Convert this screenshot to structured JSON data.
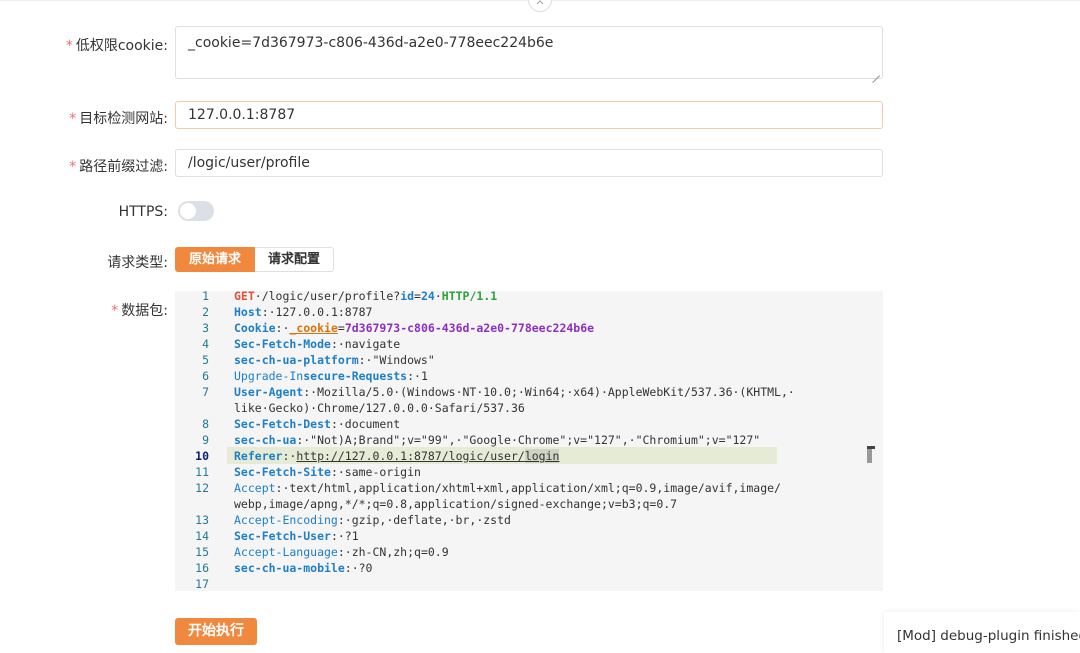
{
  "collapse_icon": "chevron-up-icon",
  "form": {
    "cookie": {
      "label": "低权限cookie",
      "required": "*",
      "colon": ":",
      "value": "_cookie=7d367973-c806-436d-a2e0-778eec224b6e"
    },
    "target": {
      "label": "目标检测网站",
      "required": "*",
      "colon": ":",
      "value": "127.0.0.1:8787"
    },
    "prefix": {
      "label": "路径前缀过滤",
      "required": "*",
      "colon": ":",
      "value": "/logic/user/profile"
    },
    "https": {
      "label": "HTTPS",
      "colon": ":",
      "enabled": false
    },
    "request_type": {
      "label": "请求类型",
      "colon": ":",
      "options": [
        "原始请求",
        "请求配置"
      ],
      "selected": "原始请求"
    },
    "packet": {
      "label": "数据包",
      "required": "*",
      "colon": ":"
    }
  },
  "editor": {
    "current_line": 10,
    "lines": [
      {
        "n": "1",
        "parts": [
          [
            "meth",
            "GET"
          ],
          [
            "",
            "·/logic/user/profile?"
          ],
          [
            "kb",
            "id"
          ],
          [
            "",
            "="
          ],
          [
            "kb",
            "24"
          ],
          [
            "",
            "·"
          ],
          [
            "proto",
            "HTTP/1.1"
          ]
        ]
      },
      {
        "n": "2",
        "parts": [
          [
            "kb",
            "Host"
          ],
          [
            "",
            ":·127.0.0.1:8787"
          ]
        ]
      },
      {
        "n": "3",
        "parts": [
          [
            "kb",
            "Cookie"
          ],
          [
            "",
            ":·"
          ],
          [
            "orange ul",
            "_cookie"
          ],
          [
            "",
            "="
          ],
          [
            "purple",
            "7d367973-c806-436d-a2e0-778eec224b6e"
          ]
        ]
      },
      {
        "n": "4",
        "parts": [
          [
            "kb",
            "Sec-Fetch-Mode"
          ],
          [
            "",
            ":·navigate"
          ]
        ]
      },
      {
        "n": "5",
        "parts": [
          [
            "kb",
            "sec-ch-ua-platform"
          ],
          [
            "",
            ":·\"Windows\""
          ]
        ]
      },
      {
        "n": "6",
        "parts": [
          [
            "k",
            "Upgrade-In"
          ],
          [
            "kb",
            "secure-Requests"
          ],
          [
            "",
            ":·1"
          ]
        ]
      },
      {
        "n": "7",
        "parts": [
          [
            "kb",
            "User-Agent"
          ],
          [
            "",
            ":·Mozilla/5.0·(Windows·NT·10.0;·Win64;·x64)·AppleWebKit/537.36·(KHTML,·"
          ]
        ]
      },
      {
        "n": "",
        "parts": [
          [
            "",
            "like·Gecko)·Chrome/127.0.0.0·Safari/537.36"
          ]
        ]
      },
      {
        "n": "8",
        "parts": [
          [
            "kb",
            "Sec-Fetch-Dest"
          ],
          [
            "",
            ":·document"
          ]
        ]
      },
      {
        "n": "9",
        "parts": [
          [
            "kb",
            "sec-ch-ua"
          ],
          [
            "",
            ":·\"Not)A;Brand\";v=\"99\",·\"Google·Chrome\";v=\"127\",·\"Chromium\";v=\"127\""
          ]
        ]
      },
      {
        "n": "10",
        "parts": [
          [
            "kb",
            "Referer"
          ],
          [
            "",
            ":·"
          ],
          [
            "ul",
            "http://127.0.0.1:8787/logic/user/"
          ],
          [
            "ul selword",
            "login"
          ]
        ]
      },
      {
        "n": "11",
        "parts": [
          [
            "kb",
            "Sec-Fetch-Site"
          ],
          [
            "",
            ":·same-origin"
          ]
        ]
      },
      {
        "n": "12",
        "parts": [
          [
            "k",
            "Accept"
          ],
          [
            "",
            ":·text/html,application/xhtml+xml,application/xml;q=0.9,image/avif,image/"
          ]
        ]
      },
      {
        "n": "",
        "parts": [
          [
            "",
            "webp,image/apng,*/*;q=0.8,application/signed-exchange;v=b3;q=0.7"
          ]
        ]
      },
      {
        "n": "13",
        "parts": [
          [
            "k",
            "Accept-Encoding"
          ],
          [
            "",
            ":·gzip,·deflate,·br,·zstd"
          ]
        ]
      },
      {
        "n": "14",
        "parts": [
          [
            "kb",
            "Sec-Fetch-User"
          ],
          [
            "",
            ":·?1"
          ]
        ]
      },
      {
        "n": "15",
        "parts": [
          [
            "k",
            "Accept-Language"
          ],
          [
            "",
            ":·zh-CN,zh;q=0.9"
          ]
        ]
      },
      {
        "n": "16",
        "parts": [
          [
            "kb",
            "sec-ch-ua-mobile"
          ],
          [
            "",
            ":·?0"
          ]
        ]
      },
      {
        "n": "17",
        "parts": []
      }
    ]
  },
  "run_button": "开始执行",
  "toast": "[Mod] debug-plugin finished",
  "colors": {
    "accent": "#f0883e",
    "required": "#f56c6c"
  }
}
